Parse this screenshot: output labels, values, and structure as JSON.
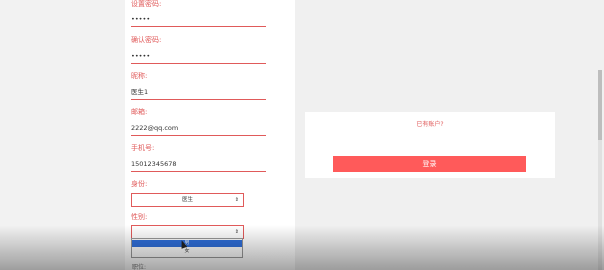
{
  "form": {
    "fields": [
      {
        "label": "设置密码:",
        "value": "•••••"
      },
      {
        "label": "确认密码:",
        "value": "•••••"
      },
      {
        "label": "昵称:",
        "value": "医生1"
      },
      {
        "label": "邮箱:",
        "value": "2222@qq.com"
      },
      {
        "label": "手机号:",
        "value": "15012345678"
      }
    ],
    "identity": {
      "label": "身份:",
      "value": "医生"
    },
    "gender": {
      "label": "性别:",
      "value": "",
      "options": [
        "男",
        "女"
      ]
    },
    "next_label": "职位:"
  },
  "card": {
    "text": "已有账户?",
    "button": "登录"
  },
  "colors": {
    "accent": "#e05a5a",
    "button": "#ff5a5a",
    "selected": "#2f6fdb"
  }
}
